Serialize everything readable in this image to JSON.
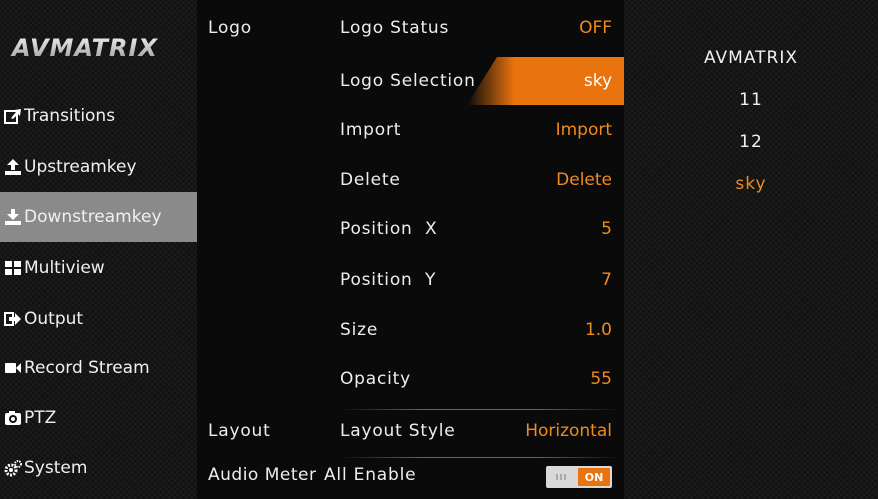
{
  "brand": {
    "logo_text": "AVMATRIX"
  },
  "sidebar": {
    "items": [
      {
        "label": "Transitions",
        "icon": "share-icon",
        "active": false
      },
      {
        "label": "Upstreamkey",
        "icon": "upload-icon",
        "active": false
      },
      {
        "label": "Downstreamkey",
        "icon": "download-icon",
        "active": true
      },
      {
        "label": "Multiview",
        "icon": "grid-icon",
        "active": false
      },
      {
        "label": "Output",
        "icon": "output-arrow-icon",
        "active": false
      },
      {
        "label": "Record Stream",
        "icon": "video-camera-icon",
        "active": false
      },
      {
        "label": "PTZ",
        "icon": "camera-icon",
        "active": false
      },
      {
        "label": "System",
        "icon": "gears-icon",
        "active": false
      }
    ]
  },
  "settings": {
    "logo_section": "Logo",
    "layout_section": "Layout",
    "audio_section": "Audio Meter",
    "rows": [
      {
        "label": "Logo Status",
        "value": "OFF"
      },
      {
        "label": "Logo Selection",
        "value": "sky"
      },
      {
        "label": "Import",
        "value": "Import"
      },
      {
        "label": "Delete",
        "value": "Delete"
      },
      {
        "label": "Position  X",
        "value": "5"
      },
      {
        "label": "Position  Y",
        "value": "7"
      },
      {
        "label": "Size",
        "value": "1.0"
      },
      {
        "label": "Opacity",
        "value": "55"
      }
    ],
    "layout_style": {
      "label": "Layout Style",
      "value": "Horizontal"
    },
    "all_enable": {
      "label": "All Enable",
      "value": "ON"
    }
  },
  "logo_list": {
    "items": [
      "AVMATRIX",
      "11",
      "12",
      "sky"
    ],
    "current": "sky"
  },
  "colors": {
    "accent": "#e8730f",
    "value_text": "#f08a1e",
    "active_nav": "#8a8a8a"
  }
}
